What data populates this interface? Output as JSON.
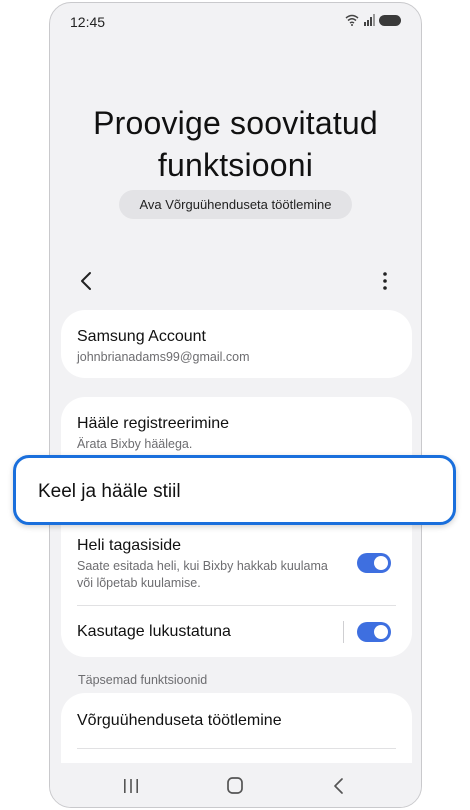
{
  "status_bar": {
    "time": "12:45"
  },
  "header": {
    "title_line1": "Proovige soovitatud",
    "title_line2": "funktsiooni",
    "suggestion_chip": "Ava Võrguühenduseta töötlemine"
  },
  "account": {
    "title": "Samsung Account",
    "email": "johnbrianadams99@gmail.com"
  },
  "voice_settings": {
    "registration_title": "Hääle registreerimine",
    "registration_sub": "Ärata Bixby häälega.",
    "sound_feedback_title": "Heli tagasiside",
    "sound_feedback_sub": "Saate esitada heli, kui Bixby hakkab kuulama või lõpetab kuulamise.",
    "sound_feedback_on": true,
    "use_locked_title": "Kasutage lukustatuna",
    "use_locked_on": true
  },
  "advanced": {
    "header": "Täpsemad funktsioonid",
    "offline_title": "Võrguühenduseta töötlemine"
  },
  "highlighted_item": {
    "label": "Keel ja hääle stiil"
  },
  "colors": {
    "accent": "#3e6fe0",
    "highlight_border": "#1a6fdc",
    "background": "#f2f2f4"
  },
  "icons": {
    "status": [
      "wifi-icon",
      "signal-icon",
      "battery-icon"
    ],
    "toolbar": [
      "back-arrow-icon",
      "more-options-icon"
    ],
    "navbar": [
      "recents-icon",
      "home-icon",
      "nav-back-icon"
    ]
  }
}
